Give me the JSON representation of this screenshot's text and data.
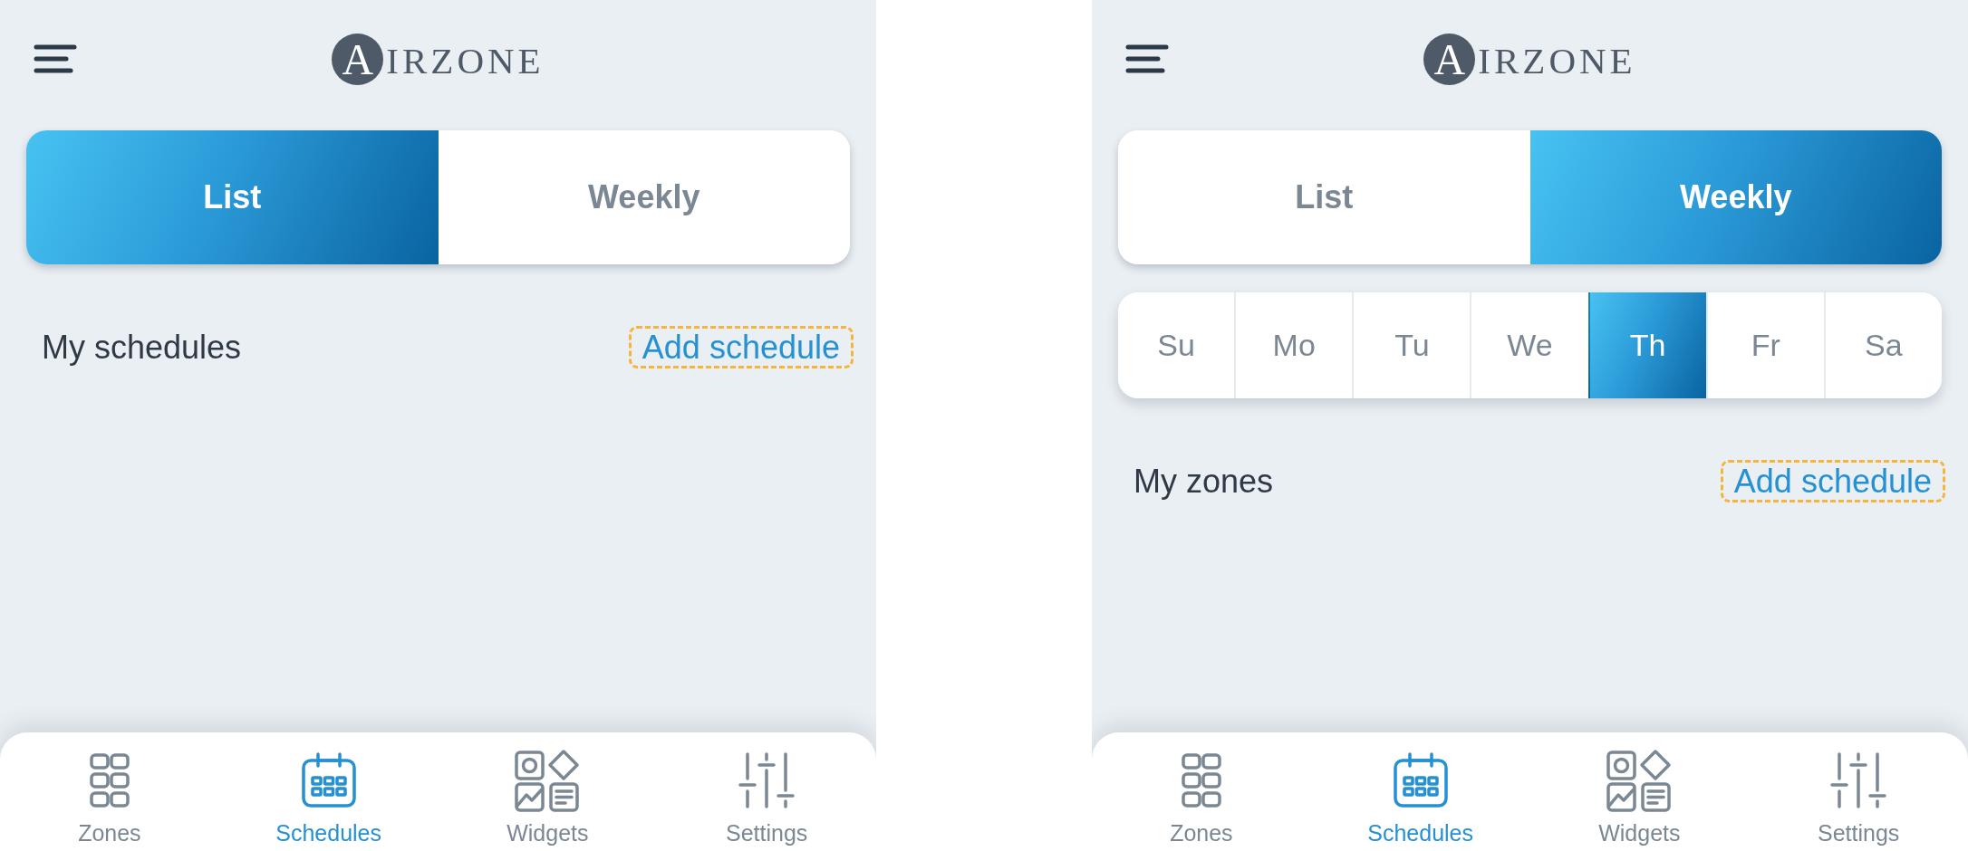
{
  "screens": [
    {
      "logo": {
        "mark": "A",
        "text": "IRZONE"
      },
      "view_tabs": [
        {
          "label": "List",
          "selected": true
        },
        {
          "label": "Weekly",
          "selected": false
        }
      ],
      "section": {
        "title": "My schedules",
        "action": {
          "label": "Add schedule",
          "focused": true
        }
      },
      "nav": [
        {
          "label": "Zones",
          "selected": false
        },
        {
          "label": "Schedules",
          "selected": true
        },
        {
          "label": "Widgets",
          "selected": false
        },
        {
          "label": "Settings",
          "selected": false
        }
      ]
    },
    {
      "logo": {
        "mark": "A",
        "text": "IRZONE"
      },
      "view_tabs": [
        {
          "label": "List",
          "selected": false
        },
        {
          "label": "Weekly",
          "selected": true
        }
      ],
      "day_tabs": [
        {
          "label": "Su",
          "selected": false
        },
        {
          "label": "Mo",
          "selected": false
        },
        {
          "label": "Tu",
          "selected": false
        },
        {
          "label": "We",
          "selected": false
        },
        {
          "label": "Th",
          "selected": true
        },
        {
          "label": "Fr",
          "selected": false
        },
        {
          "label": "Sa",
          "selected": false
        }
      ],
      "section": {
        "title": "My zones",
        "action": {
          "label": "Add schedule",
          "focused": true
        }
      },
      "nav": [
        {
          "label": "Zones",
          "selected": false
        },
        {
          "label": "Schedules",
          "selected": true
        },
        {
          "label": "Widgets",
          "selected": false
        },
        {
          "label": "Settings",
          "selected": false
        }
      ]
    }
  ]
}
